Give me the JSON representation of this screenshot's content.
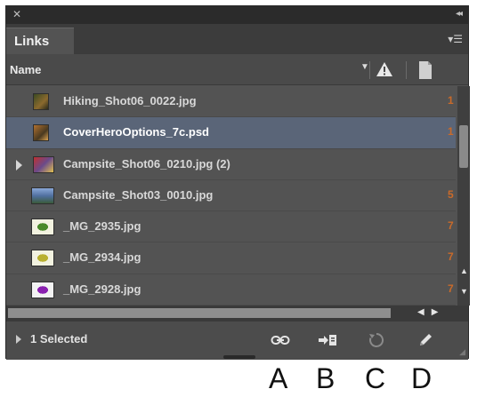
{
  "panel": {
    "tab_label": "Links",
    "column_name_label": "Name",
    "status_text": "1 Selected"
  },
  "rows": [
    {
      "name": "Hiking_Shot06_0022.jpg",
      "page": "1",
      "selected": false,
      "expandable": false,
      "thumb": "photo-dark"
    },
    {
      "name": "CoverHeroOptions_7c.psd",
      "page": "1",
      "selected": true,
      "expandable": false,
      "thumb": "photo-warm"
    },
    {
      "name": "Campsite_Shot06_0210.jpg (2)",
      "page": "",
      "selected": false,
      "expandable": true,
      "thumb": "photo-red"
    },
    {
      "name": "Campsite_Shot03_0010.jpg",
      "page": "5",
      "selected": false,
      "expandable": false,
      "thumb": "photo-landscape"
    },
    {
      "name": "_MG_2935.jpg",
      "page": "7",
      "selected": false,
      "expandable": false,
      "thumb": "graphic-green"
    },
    {
      "name": "_MG_2934.jpg",
      "page": "7",
      "selected": false,
      "expandable": false,
      "thumb": "graphic-yellow"
    },
    {
      "name": "_MG_2928.jpg",
      "page": "7",
      "selected": false,
      "expandable": false,
      "thumb": "graphic-purple"
    }
  ],
  "footer_buttons": [
    {
      "icon": "relink-chain-icon",
      "callout": "A"
    },
    {
      "icon": "go-to-link-icon",
      "callout": "B"
    },
    {
      "icon": "update-link-icon",
      "callout": "C"
    },
    {
      "icon": "edit-original-pencil-icon",
      "callout": "D"
    }
  ],
  "colors": {
    "panel_bg": "#535353",
    "selected_row": "#5a6578",
    "page_number": "#c96a2a"
  }
}
